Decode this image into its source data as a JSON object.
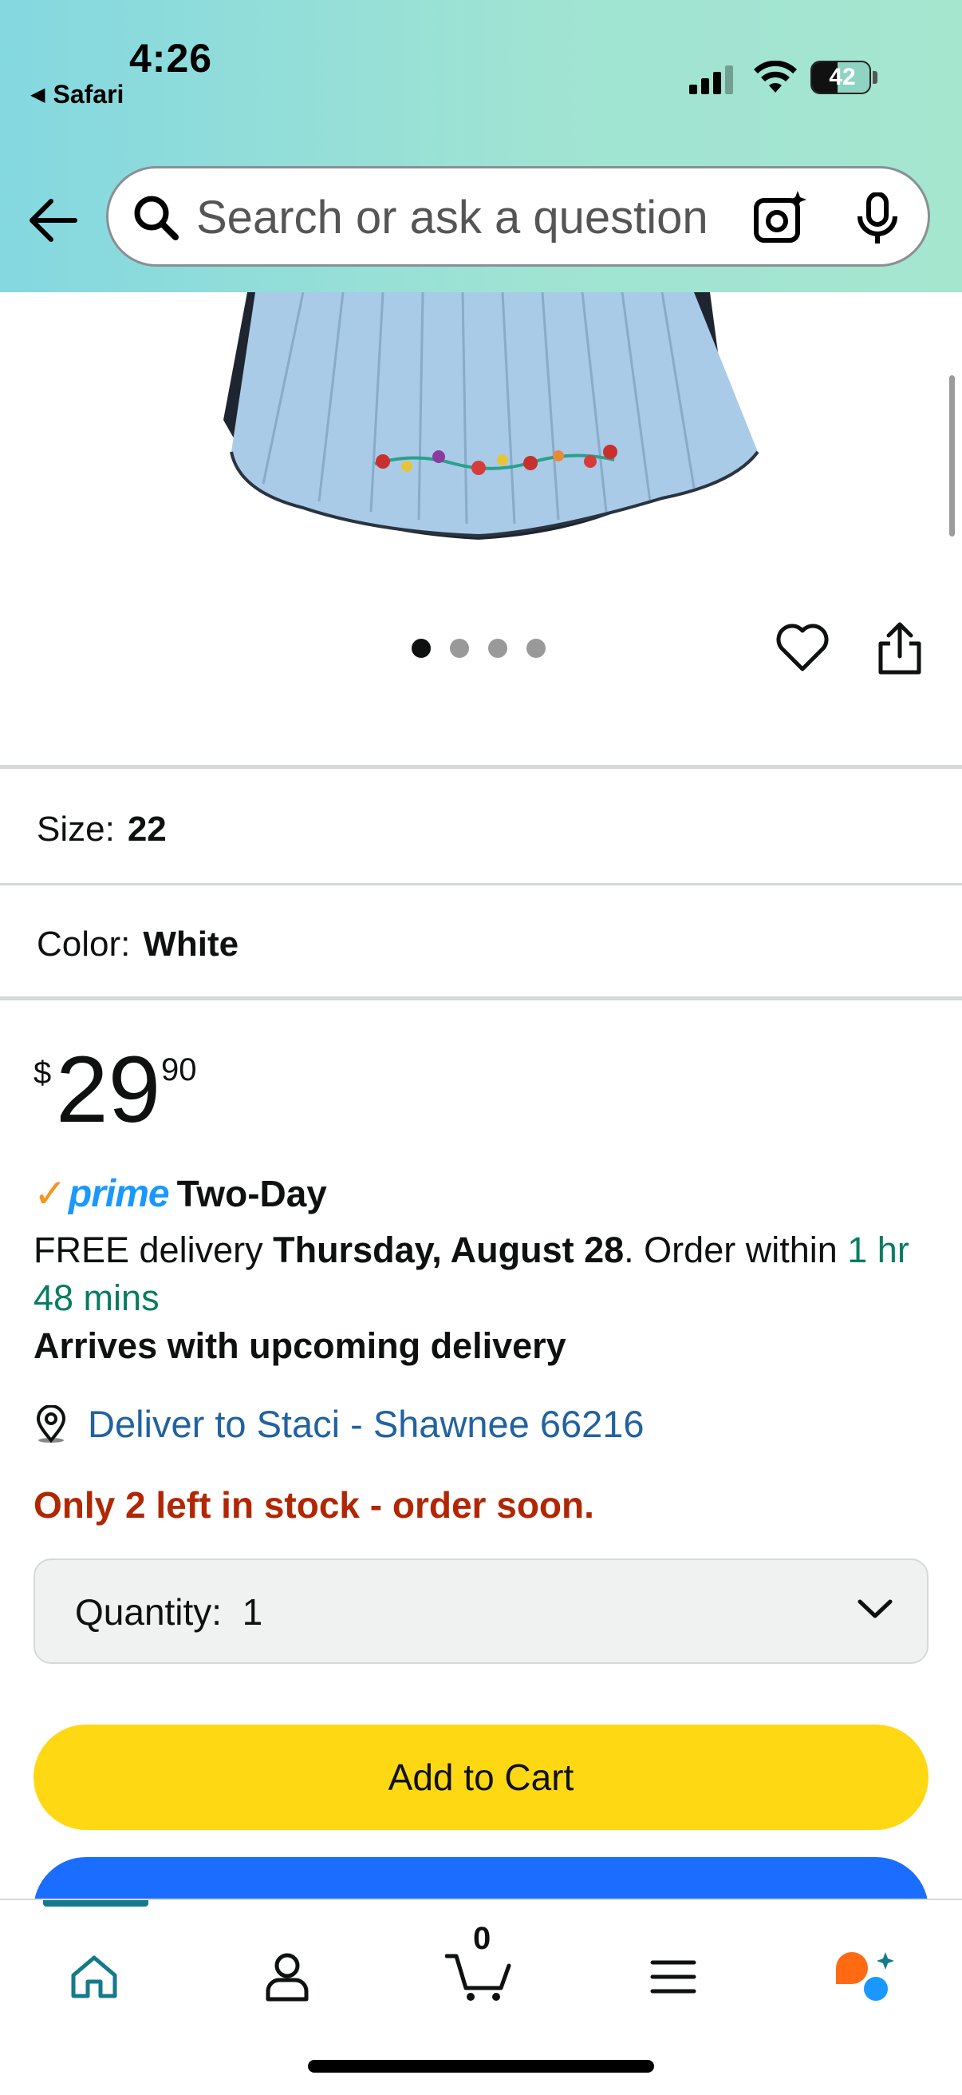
{
  "status_bar": {
    "time": "4:26",
    "back_app": "Safari",
    "battery": "42"
  },
  "search": {
    "placeholder": "Search or ask a question",
    "icons": [
      "back-arrow-icon",
      "search-icon",
      "camera-lens-icon",
      "microphone-icon"
    ]
  },
  "gallery": {
    "page_count": 4,
    "active_index": 0,
    "icons": [
      "heart-icon",
      "share-icon"
    ]
  },
  "variations": {
    "size_label": "Size:",
    "size_value": "22",
    "color_label": "Color:",
    "color_value": "White"
  },
  "price": {
    "symbol": "$",
    "whole": "29",
    "fraction": "90"
  },
  "delivery": {
    "prime_label": "prime",
    "prime_speed": "Two-Day",
    "free_text": "FREE delivery ",
    "date": "Thursday, August 28",
    "order_within": ". Order within ",
    "countdown": "1 hr 48 mins",
    "arrives_text": "Arrives with upcoming delivery",
    "deliver_to": "Deliver to Staci - Shawnee 66216"
  },
  "stock_message": "Only 2 left in stock - order soon.",
  "quantity": {
    "label": "Quantity:",
    "value": "1"
  },
  "buttons": {
    "add_to_cart": "Add to Cart"
  },
  "tabbar": {
    "cart_count": "0",
    "items": [
      "home-icon",
      "account-icon",
      "cart-icon",
      "menu-icon",
      "rufus-ai-icon"
    ],
    "active": "home-icon"
  },
  "colors": {
    "header_gradient": "#84d8e0",
    "add_to_cart": "#ffd814",
    "buy_now": "#1a6dff",
    "stock_red": "#b12704",
    "link_blue": "#2162a1",
    "countdown_green": "#067d62",
    "prime_blue": "#1a98ff"
  }
}
